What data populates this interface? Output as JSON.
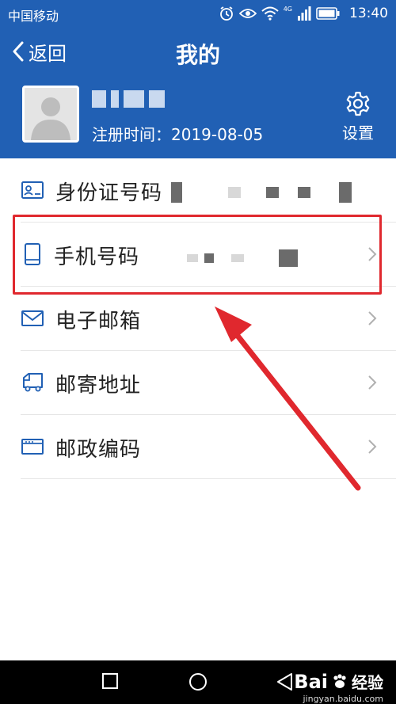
{
  "status_bar": {
    "carrier": "中国移动",
    "network": "4G",
    "time": "13:40"
  },
  "nav": {
    "back_label": "返回",
    "title": "我的"
  },
  "profile": {
    "registration": "注册时间：2019-08-05",
    "settings_label": "设置"
  },
  "menu": [
    {
      "label": "身份证号码",
      "icon": "id-card-icon",
      "chevron": false
    },
    {
      "label": "手机号码",
      "icon": "mobile-phone-icon",
      "chevron": true
    },
    {
      "label": "电子邮箱",
      "icon": "mail-icon",
      "chevron": true
    },
    {
      "label": "邮寄地址",
      "icon": "delivery-truck-icon",
      "chevron": true
    },
    {
      "label": "邮政编码",
      "icon": "postal-code-icon",
      "chevron": true
    }
  ],
  "watermark": {
    "brand": "Bai",
    "brand_suffix": "经验",
    "url": "jingyan.baidu.com"
  },
  "colors": {
    "header_blue": "#2160b4",
    "highlight_red": "#e0282e",
    "icon_blue": "#2160b4"
  }
}
